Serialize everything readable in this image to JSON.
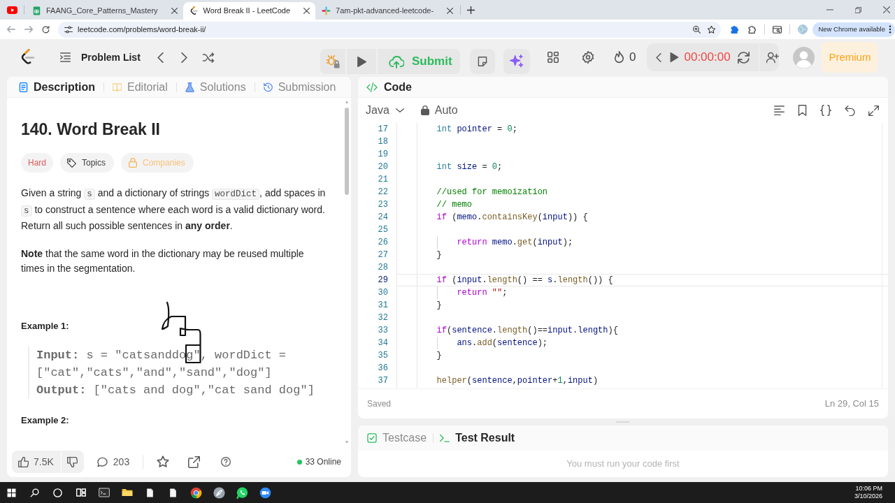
{
  "browser": {
    "tabs": [
      {
        "title": "FAANG_Core_Patterns_Mastery",
        "selected": false
      },
      {
        "title": "Word Break II - LeetCode",
        "selected": true
      },
      {
        "title": "7am-pkt-advanced-leetcode-",
        "selected": false
      }
    ],
    "url": "leetcode.com/problems/word-break-ii/",
    "update_chip": "New Chrome available"
  },
  "navbar": {
    "problem_list": "Problem List",
    "submit": "Submit",
    "streak": "0",
    "timer": "00:00:00",
    "premium": "Premium"
  },
  "description_panel": {
    "tabs": [
      {
        "label": "Description",
        "selected": true
      },
      {
        "label": "Editorial",
        "selected": false
      },
      {
        "label": "Solutions",
        "selected": false
      },
      {
        "label": "Submission",
        "selected": false
      }
    ],
    "title": "140. Word Break II",
    "tags": [
      {
        "kind": "difficulty",
        "label": "Hard"
      },
      {
        "kind": "topics",
        "label": "Topics"
      },
      {
        "kind": "companies",
        "label": "Companies"
      }
    ],
    "statement": [
      {
        "kind": "text",
        "text": "Given a string "
      },
      {
        "kind": "code",
        "text": "s"
      },
      {
        "kind": "text",
        "text": " and a dictionary of strings "
      },
      {
        "kind": "code",
        "text": "wordDict"
      },
      {
        "kind": "text",
        "text": ", add spaces in "
      },
      {
        "kind": "code",
        "text": "s"
      },
      {
        "kind": "text",
        "text": " to construct a sentence where each word is a valid dictionary word. Return all such possible sentences in **any order**."
      }
    ],
    "note": "**Note** that the same word in the dictionary may be reused multiple times in the segmentation.",
    "examples": [
      {
        "title": "Example 1:",
        "lines": [
          "**Input:** s = \"catsanddog\", wordDict = [\"cat\",\"cats\",\"and\",\"sand\",\"dog\"]",
          "**Output:** [\"cats and dog\",\"cat sand dog\"]"
        ]
      },
      {
        "title": "Example 2:"
      }
    ],
    "footer": {
      "likes": "7.5K",
      "comments": "203",
      "online": "33 Online"
    }
  },
  "code_panel": {
    "title": "Code",
    "language": "Java",
    "mode": "Auto",
    "lines": [
      {
        "number": "17",
        "active": false,
        "tokens": [
          {
            "kind": "type",
            "text": "        int "
          },
          {
            "kind": "variable",
            "text": "pointer"
          },
          {
            "kind": "plain",
            "text": " = "
          },
          {
            "kind": "number",
            "text": "0"
          },
          {
            "kind": "plain",
            "text": ";"
          }
        ]
      },
      {
        "number": "18",
        "active": false
      },
      {
        "number": "19",
        "active": false
      },
      {
        "number": "20",
        "active": false,
        "tokens": [
          {
            "kind": "type",
            "text": "        int "
          },
          {
            "kind": "variable",
            "text": "size"
          },
          {
            "kind": "plain",
            "text": " = "
          },
          {
            "kind": "number",
            "text": "0"
          },
          {
            "kind": "plain",
            "text": ";"
          }
        ]
      },
      {
        "number": "21",
        "active": false
      },
      {
        "number": "22",
        "active": false,
        "tokens": [
          {
            "kind": "comment",
            "text": "        //used for memoization"
          }
        ]
      },
      {
        "number": "23",
        "active": false,
        "tokens": [
          {
            "kind": "comment",
            "text": "        // memo"
          }
        ]
      },
      {
        "number": "24",
        "active": false,
        "tokens": [
          {
            "kind": "keyword",
            "text": "        if"
          },
          {
            "kind": "plain",
            "text": " ("
          },
          {
            "kind": "variable",
            "text": "memo"
          },
          {
            "kind": "plain",
            "text": "."
          },
          {
            "kind": "method",
            "text": "containsKey"
          },
          {
            "kind": "plain",
            "text": "("
          },
          {
            "kind": "variable",
            "text": "input"
          },
          {
            "kind": "plain",
            "text": ")) {"
          }
        ]
      },
      {
        "number": "25",
        "active": false
      },
      {
        "number": "26",
        "active": false,
        "tokens": [
          {
            "kind": "keyword",
            "text": "            return "
          },
          {
            "kind": "variable",
            "text": "memo"
          },
          {
            "kind": "plain",
            "text": "."
          },
          {
            "kind": "method",
            "text": "get"
          },
          {
            "kind": "plain",
            "text": "("
          },
          {
            "kind": "variable",
            "text": "input"
          },
          {
            "kind": "plain",
            "text": ");"
          }
        ]
      },
      {
        "number": "27",
        "active": false,
        "tokens": [
          {
            "kind": "plain",
            "text": "        }"
          }
        ]
      },
      {
        "number": "28",
        "active": false
      },
      {
        "number": "29",
        "active": true,
        "tokens": [
          {
            "kind": "keyword",
            "text": "        if"
          },
          {
            "kind": "plain",
            "text": " ("
          },
          {
            "kind": "variable",
            "text": "input"
          },
          {
            "kind": "plain",
            "text": "."
          },
          {
            "kind": "method",
            "text": "length"
          },
          {
            "kind": "plain",
            "text": "() == "
          },
          {
            "kind": "variable",
            "text": "s"
          },
          {
            "kind": "plain",
            "text": "."
          },
          {
            "kind": "method",
            "text": "length"
          },
          {
            "kind": "plain",
            "text": "()) {"
          }
        ]
      },
      {
        "number": "30",
        "active": false,
        "tokens": [
          {
            "kind": "keyword",
            "text": "            return "
          },
          {
            "kind": "string",
            "text": "\"\""
          },
          {
            "kind": "plain",
            "text": ";"
          }
        ]
      },
      {
        "number": "31",
        "active": false,
        "tokens": [
          {
            "kind": "plain",
            "text": "        }"
          }
        ]
      },
      {
        "number": "32",
        "active": false
      },
      {
        "number": "33",
        "active": false,
        "tokens": [
          {
            "kind": "keyword",
            "text": "        if"
          },
          {
            "kind": "plain",
            "text": "("
          },
          {
            "kind": "variable",
            "text": "sentence"
          },
          {
            "kind": "plain",
            "text": "."
          },
          {
            "kind": "method",
            "text": "length"
          },
          {
            "kind": "plain",
            "text": "()=="
          },
          {
            "kind": "variable",
            "text": "input"
          },
          {
            "kind": "plain",
            "text": "."
          },
          {
            "kind": "variable",
            "text": "length"
          },
          {
            "kind": "plain",
            "text": "){"
          }
        ]
      },
      {
        "number": "34",
        "active": false,
        "tokens": [
          {
            "kind": "variable",
            "text": "            ans"
          },
          {
            "kind": "plain",
            "text": "."
          },
          {
            "kind": "method",
            "text": "add"
          },
          {
            "kind": "plain",
            "text": "("
          },
          {
            "kind": "variable",
            "text": "sentence"
          },
          {
            "kind": "plain",
            "text": ");"
          }
        ]
      },
      {
        "number": "35",
        "active": false,
        "tokens": [
          {
            "kind": "plain",
            "text": "        }"
          }
        ]
      },
      {
        "number": "36",
        "active": false
      },
      {
        "number": "37",
        "active": false,
        "tokens": [
          {
            "kind": "method",
            "text": "        helper"
          },
          {
            "kind": "plain",
            "text": "("
          },
          {
            "kind": "variable",
            "text": "sentence"
          },
          {
            "kind": "plain",
            "text": ","
          },
          {
            "kind": "variable",
            "text": "pointer"
          },
          {
            "kind": "plain",
            "text": "+"
          },
          {
            "kind": "number",
            "text": "1"
          },
          {
            "kind": "plain",
            "text": ","
          },
          {
            "kind": "variable",
            "text": "input"
          },
          {
            "kind": "plain",
            "text": ")"
          }
        ]
      }
    ],
    "status": "Saved",
    "cursor": "Ln 29, Col 15"
  },
  "test_panel": {
    "tabs": [
      {
        "label": "Testcase",
        "selected": false
      },
      {
        "label": "Test Result",
        "selected": true
      }
    ],
    "message": "You must run your code first"
  },
  "taskbar": {
    "time": "10:06 PM",
    "date": "3/10/2026"
  }
}
